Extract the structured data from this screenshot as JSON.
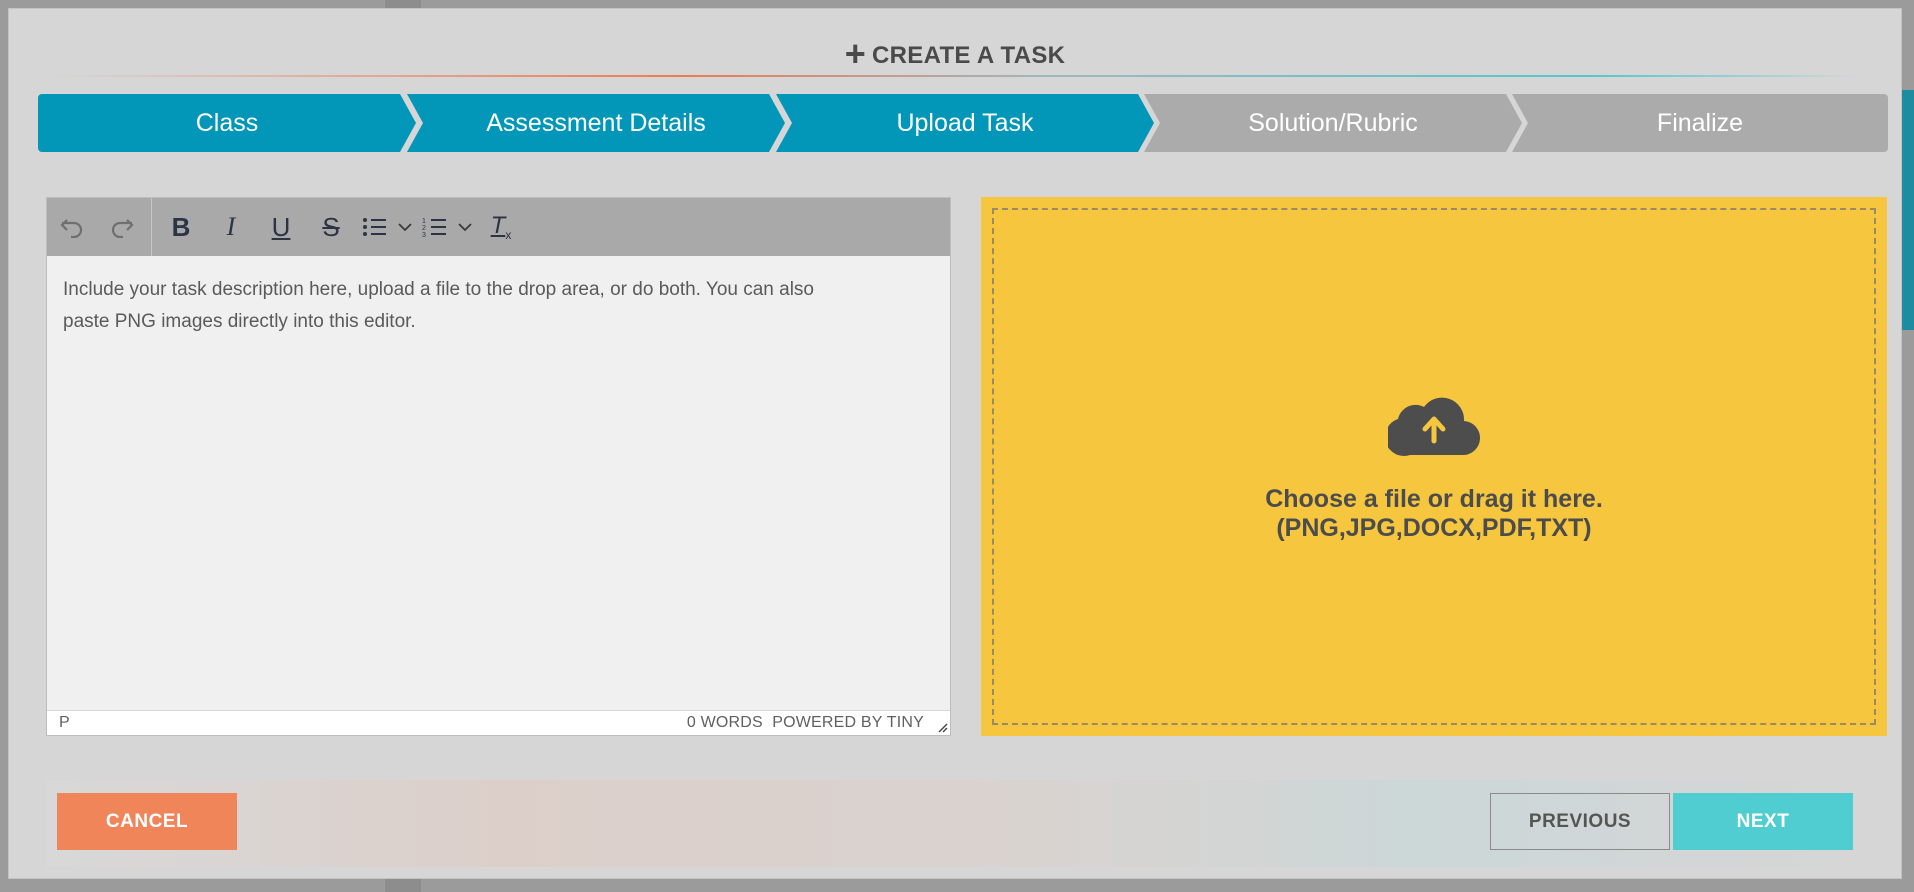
{
  "modal": {
    "title": "CREATE A TASK",
    "title_icon": "plus-icon"
  },
  "stepper": {
    "steps": [
      {
        "label": "Class",
        "state": "active"
      },
      {
        "label": "Assessment Details",
        "state": "active"
      },
      {
        "label": "Upload Task",
        "state": "active"
      },
      {
        "label": "Solution/Rubric",
        "state": "inactive"
      },
      {
        "label": "Finalize",
        "state": "inactive"
      }
    ],
    "active_color": "#0296b8",
    "inactive_color": "#ababab"
  },
  "editor": {
    "toolbar": {
      "undo_icon": "↶",
      "redo_icon": "↷",
      "bold_icon": "B",
      "italic_icon": "I",
      "underline_icon": "U",
      "strikethrough_icon": "S",
      "bullet_list_icon": "☰",
      "numbered_list_icon": "☰",
      "clear_format_icon": "Tx",
      "chevron": "⌄"
    },
    "placeholder_line1": "Include your task description here, upload a file to the drop area, or do both. You can also",
    "placeholder_line2": "paste PNG images directly into this editor.",
    "status_path": "P",
    "word_count": "0 WORDS",
    "powered_by": "POWERED BY TINY"
  },
  "dropzone": {
    "icon": "cloud-upload-icon",
    "line1": "Choose a file or drag it here.",
    "line2": "(PNG,JPG,DOCX,PDF,TXT)",
    "color": "#f5c63e"
  },
  "footer": {
    "cancel_label": "CANCEL",
    "previous_label": "PREVIOUS",
    "next_label": "NEXT"
  }
}
